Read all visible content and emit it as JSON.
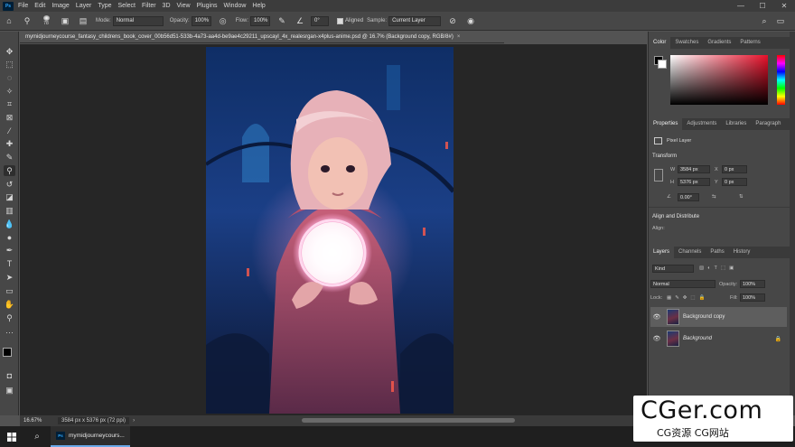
{
  "app": {
    "logo": "Ps"
  },
  "menu": [
    "File",
    "Edit",
    "Image",
    "Layer",
    "Type",
    "Select",
    "Filter",
    "3D",
    "View",
    "Plugins",
    "Window",
    "Help"
  ],
  "window_controls": {
    "minimize": "—",
    "maximize": "☐",
    "close": "✕"
  },
  "options": {
    "brush_size": "78",
    "mode_label": "Mode:",
    "mode_value": "Normal",
    "opacity_label": "Opacity:",
    "opacity_value": "100%",
    "flow_label": "Flow:",
    "flow_value": "100%",
    "angle_value": "0°",
    "aligned_label": "Aligned",
    "sample_label": "Sample:",
    "sample_value": "Current Layer"
  },
  "document": {
    "tab_title": "mymidjourneycourse_fantasy_childrens_book_cover_00b56d51-533b-4a73-aa4d-be9ae4c29211_upscayl_4x_realesrgan-x4plus-anime.psd @ 16.7% (Background copy, RGB/8#)",
    "close": "×"
  },
  "status": {
    "zoom": "16.67%",
    "info": "3584 px x 5376 px (72 ppi)",
    "arrow": "›"
  },
  "color_panel": {
    "tabs": [
      "Color",
      "Swatches",
      "Gradients",
      "Patterns"
    ]
  },
  "properties_panel": {
    "tabs": [
      "Properties",
      "Adjustments",
      "Libraries",
      "Paragraph"
    ],
    "layer_type": "Pixel Layer",
    "transform_head": "Transform",
    "w_label": "W",
    "w_value": "3584 px",
    "h_label": "H",
    "h_value": "5376 px",
    "x_label": "X",
    "x_value": "0 px",
    "y_label": "Y",
    "y_value": "0 px",
    "angle_value": "0.00°",
    "align_head": "Align and Distribute",
    "align_label": "Align:"
  },
  "layers_panel": {
    "tabs": [
      "Layers",
      "Channels",
      "Paths",
      "History"
    ],
    "filter_kind": "Kind",
    "blend_mode": "Normal",
    "opacity_label": "Opacity:",
    "opacity_value": "100%",
    "lock_label": "Lock:",
    "fill_label": "Fill:",
    "fill_value": "100%",
    "layers": [
      {
        "name": "Background copy",
        "selected": true
      },
      {
        "name": "Background",
        "selected": false
      }
    ]
  },
  "taskbar": {
    "app_label": "mymidjourneycours..."
  },
  "watermark": {
    "line1": "CGer.com",
    "line2": "CG资源 CG网站"
  },
  "colors": {
    "accent": "#31a8ff",
    "panel": "#474747",
    "canvas_bg": "#262626"
  }
}
